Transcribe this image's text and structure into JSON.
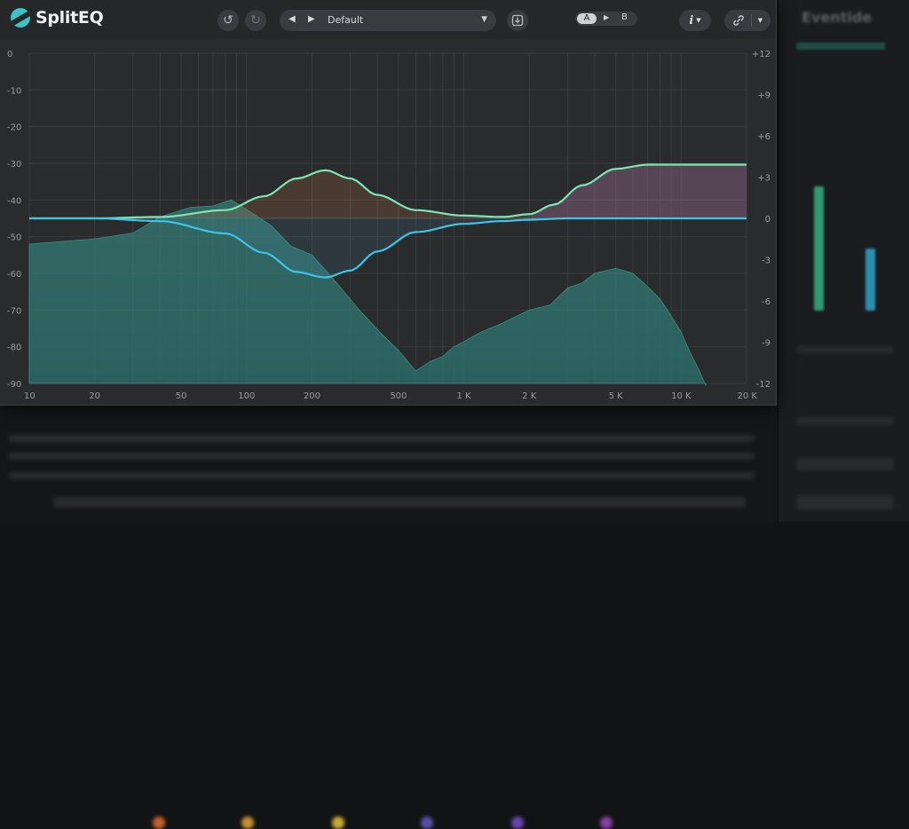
{
  "app": {
    "name": "SplitEQ"
  },
  "toolbar": {
    "undo_icon": "undo-icon",
    "redo_icon": "redo-icon",
    "prev_label": "◀",
    "next_label": "▶",
    "preset_name": "Default",
    "save_icon": "save-icon",
    "ab_a": "A",
    "ab_mid": "▶",
    "ab_b": "B",
    "info_label": "i",
    "link_icon": "link-icon"
  },
  "background_panel": {
    "title": "Eventide"
  },
  "colors": {
    "curve_green": "#7ce6b4",
    "curve_blue": "#3cc6e6",
    "accent": "#39c4c6"
  },
  "chart_data": {
    "type": "area",
    "x_scale": "log",
    "xlim": [
      10,
      20000
    ],
    "x_ticks": [
      10,
      20,
      50,
      100,
      200,
      500,
      1000,
      2000,
      5000,
      10000,
      20000
    ],
    "x_tick_labels": [
      "10",
      "20",
      "50",
      "100",
      "200",
      "500",
      "1 K",
      "2 K",
      "5 K",
      "10 K",
      "20 K"
    ],
    "y_left_ticks": [
      0,
      -10,
      -20,
      -30,
      -40,
      -50,
      -60,
      -70,
      -80,
      -90
    ],
    "y_left_labels": [
      "0",
      "-10",
      "-20",
      "-30",
      "-40",
      "-50",
      "-60",
      "-70",
      "-80",
      "-90"
    ],
    "y_left_lim": [
      -90,
      0
    ],
    "y_right_ticks": [
      12,
      9,
      6,
      3,
      0,
      -3,
      -6,
      -9,
      -12
    ],
    "y_right_labels": [
      "+12",
      "+9",
      "+6",
      "+3",
      "0",
      "-3",
      "-6",
      "-9",
      "-12"
    ],
    "y_right_lim": [
      -12,
      12
    ],
    "series": [
      {
        "color": "#7ce6b4",
        "x": [
          10,
          20,
          40,
          80,
          120,
          170,
          230,
          300,
          400,
          600,
          1000,
          1500,
          2000,
          2600,
          3500,
          5000,
          7000,
          10000,
          20000
        ],
        "y": [
          0,
          0,
          0.1,
          0.6,
          1.6,
          2.9,
          3.5,
          2.9,
          1.7,
          0.6,
          0.2,
          0.1,
          0.3,
          1.0,
          2.4,
          3.6,
          3.9,
          3.9,
          3.9
        ]
      },
      {
        "color": "#3cc6e6",
        "x": [
          10,
          20,
          40,
          80,
          120,
          170,
          230,
          300,
          400,
          600,
          1000,
          1500,
          2000,
          3000,
          5000,
          10000,
          20000
        ],
        "y": [
          0,
          0,
          -0.2,
          -1.1,
          -2.5,
          -3.9,
          -4.3,
          -3.8,
          -2.4,
          -1.0,
          -0.4,
          -0.2,
          -0.1,
          0,
          0,
          0,
          0
        ]
      }
    ],
    "spectrum": {
      "color": "#2f6f6a",
      "x": [
        10,
        20,
        30,
        40,
        55,
        70,
        85,
        100,
        130,
        160,
        200,
        260,
        330,
        420,
        500,
        600,
        700,
        800,
        900,
        1000,
        1200,
        1500,
        2000,
        2500,
        3000,
        3500,
        4000,
        5000,
        6000,
        7000,
        8000,
        9000,
        10000,
        11000,
        12000,
        13000
      ],
      "y": [
        -52,
        -50,
        -49,
        -44,
        -42,
        -41,
        -40,
        -42,
        -47,
        -52,
        -55,
        -62,
        -70,
        -76,
        -81,
        -86,
        -84,
        -82,
        -80,
        -78,
        -76,
        -73,
        -70,
        -68,
        -64,
        -62,
        -60,
        -58,
        -60,
        -63,
        -67,
        -71,
        -76,
        -81,
        -86,
        -90
      ]
    }
  }
}
